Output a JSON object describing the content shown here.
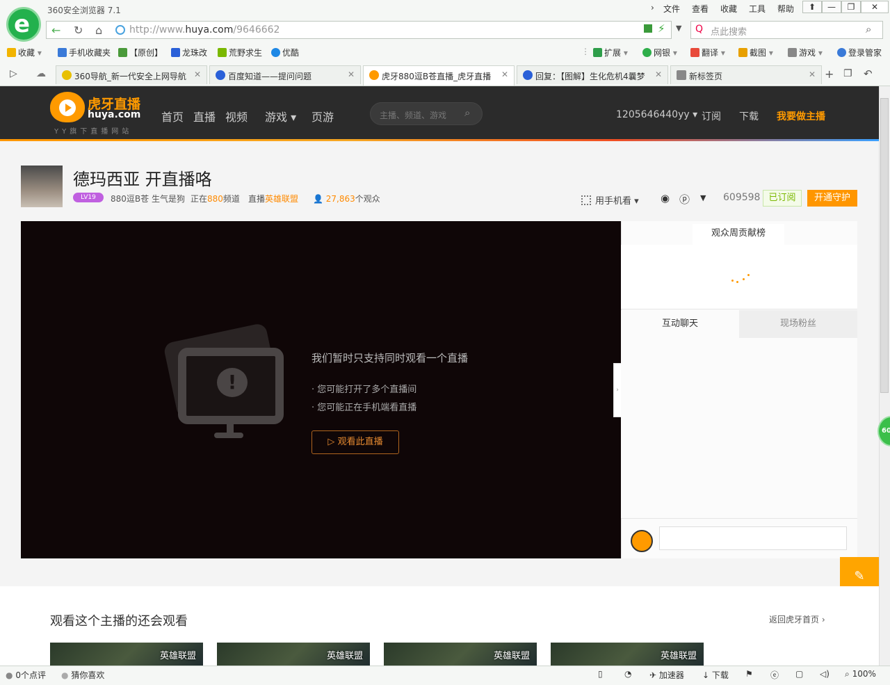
{
  "browser": {
    "title": "360安全浏览器 7.1",
    "menus": [
      "文件",
      "查看",
      "收藏",
      "工具",
      "帮助"
    ],
    "window_buttons": [
      "⬆",
      "—",
      "❐",
      "✕"
    ],
    "address": {
      "url_prefix": "http://www.",
      "url_domain": "huya.com",
      "url_path": "/9646662"
    },
    "search_placeholder": "点此搜索",
    "bookmarks": [
      "收藏",
      "手机收藏夹",
      "【原创】",
      "龙珠改",
      "荒野求生",
      "优酷"
    ],
    "tools": [
      "扩展",
      "网银",
      "翻译",
      "截图",
      "游戏",
      "登录管家"
    ],
    "tabs": [
      {
        "label": "360导航_新一代安全上网导航",
        "icon_color": "#e8c000"
      },
      {
        "label": "百度知道——提问问题",
        "icon_color": "#2a60d8"
      },
      {
        "label": "虎牙880逗B苍直播_虎牙直播",
        "icon_color": "#ff9a00"
      },
      {
        "label": "回复：【图解】生化危机4曩梦",
        "icon_color": "#2a60d8"
      },
      {
        "label": "新标签页",
        "icon_color": "#888888"
      }
    ],
    "active_tab_index": 2,
    "zoom": "100%",
    "status_left": [
      "0个点评",
      "猜你喜欢"
    ],
    "status_right": [
      "加速器",
      "下载"
    ]
  },
  "huya": {
    "brand": "虎牙直播",
    "domain": "huya.com",
    "tagline": "YY旗下直播网站",
    "nav": [
      "首页",
      "直播",
      "视频",
      "游戏 ▾",
      "页游"
    ],
    "search_placeholder": "主播、频道、游戏",
    "user": "1205646440yy ▾",
    "subscribe": "订阅",
    "download": "下载",
    "become_streamer": "我要做主播"
  },
  "room": {
    "title": "德玛西亚 开直播咯",
    "level": "LV19",
    "streamer": "880逗B苍 生气是狗",
    "channel_prefix": "正在",
    "channel_num": "880",
    "channel_suffix": "频道",
    "game_prefix": "直播",
    "game": "英雄联盟",
    "viewers": "27,863",
    "viewers_suffix": "个观众",
    "mobile_watch": "用手机看",
    "sub_count": "609598",
    "subscribed": "已订阅",
    "guard": "开通守护"
  },
  "player": {
    "message": "我们暂时只支持同时观看一个直播",
    "reasons": [
      "· 您可能打开了多个直播间",
      "· 您可能正在手机端看直播"
    ],
    "watch_button": "观看此直播"
  },
  "sidebar": {
    "rank_tab": "观众周贡献榜",
    "chat_tab": "互动聊天",
    "fans_tab": "现场粉丝"
  },
  "lower": {
    "title": "观看这个主播的还会观看",
    "back_home": "返回虎牙首页 ›",
    "thumbs": [
      "英雄联盟",
      "英雄联盟",
      "英雄联盟",
      "英雄联盟"
    ]
  }
}
